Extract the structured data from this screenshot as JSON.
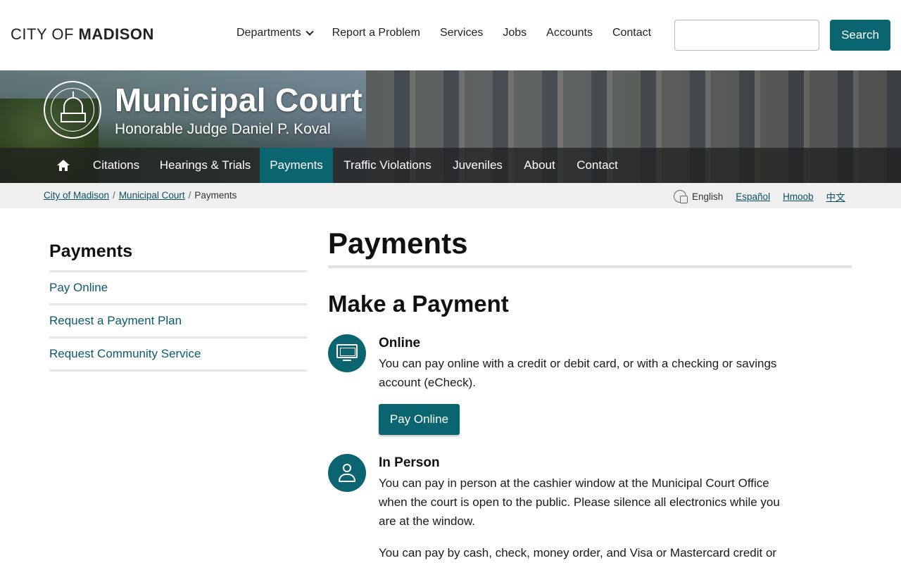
{
  "header": {
    "logo_light": "CITY OF",
    "logo_bold": "MADISON",
    "nav": [
      "Departments",
      "Report a Problem",
      "Services",
      "Jobs",
      "Accounts",
      "Contact"
    ],
    "search_value": "",
    "search_button": "Search"
  },
  "banner": {
    "seal_text": "CITY OF MADISON MUNICIPAL COURT",
    "title": "Municipal Court",
    "subtitle": "Honorable Judge Daniel P. Koval",
    "tabs": [
      "Citations",
      "Hearings & Trials",
      "Payments",
      "Traffic Violations",
      "Juveniles",
      "About",
      "Contact"
    ],
    "active_tab": "Payments"
  },
  "breadcrumb": {
    "items": [
      "City of Madison",
      "Municipal Court",
      "Payments"
    ],
    "separator": "/"
  },
  "languages": {
    "current": "English",
    "links": [
      "Español",
      "Hmoob",
      "中文"
    ]
  },
  "sidebar": {
    "title": "Payments",
    "links": [
      "Pay Online",
      "Request a Payment Plan",
      "Request Community Service"
    ]
  },
  "main": {
    "title": "Payments",
    "section_heading": "Make a Payment",
    "online": {
      "title": "Online",
      "text": "You can pay online with a credit or debit card, or with a checking or savings account (eCheck).",
      "button": "Pay Online"
    },
    "in_person": {
      "title": "In Person",
      "text": "You can pay in person at the cashier window at the Municipal Court Office when the court is open to the public. Please silence all electronics while you are at the window.",
      "text2": "You can pay by cash, check, money order, and Visa or Mastercard credit or"
    }
  },
  "colors": {
    "accent": "#0b6570",
    "link": "#0b5a6e",
    "crumb_bar": "#efefef"
  },
  "icons": [
    "chevron-down-icon",
    "home-icon",
    "translate-icon",
    "monitor-icon",
    "person-icon",
    "city-seal"
  ]
}
